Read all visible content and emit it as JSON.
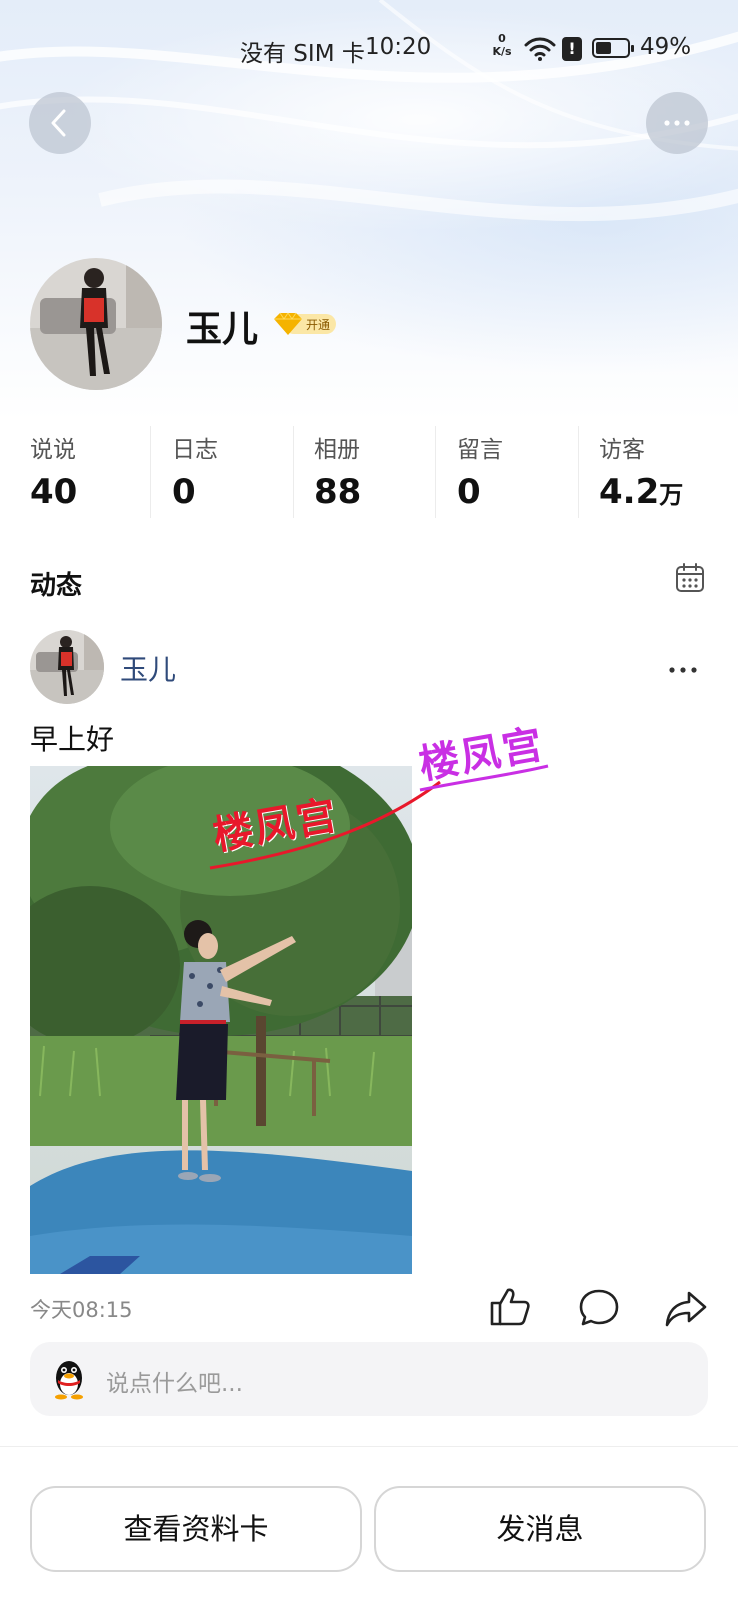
{
  "status_bar": {
    "carrier": "没有 SIM 卡",
    "time": "10:20",
    "net_speed_value": "0",
    "net_speed_unit": "K/s",
    "alert": "!",
    "battery_level": 0.49,
    "battery_percent": "49%"
  },
  "header": {
    "back_icon": "chevron-left-icon",
    "more_icon": "ellipsis-icon"
  },
  "profile": {
    "name": "玉儿",
    "vip_badge_label": "开通",
    "vip_icon": "diamond-icon"
  },
  "stats": [
    {
      "label": "说说",
      "value": "40",
      "unit": ""
    },
    {
      "label": "日志",
      "value": "0",
      "unit": ""
    },
    {
      "label": "相册",
      "value": "88",
      "unit": ""
    },
    {
      "label": "留言",
      "value": "0",
      "unit": ""
    },
    {
      "label": "访客",
      "value": "4.2",
      "unit": "万"
    }
  ],
  "feed": {
    "title": "动态",
    "calendar_icon": "calendar-icon"
  },
  "post": {
    "author": "玉儿",
    "text": "早上好",
    "watermark_1": "楼凤宫",
    "watermark_2": "楼凤宫",
    "time": "今天08:15",
    "actions": [
      "like-icon",
      "comment-icon",
      "share-icon"
    ]
  },
  "comment_input": {
    "placeholder": "说点什么吧..."
  },
  "bottom_actions": {
    "view_card": "查看资料卡",
    "send_message": "发消息"
  },
  "colors": {
    "author_link": "#2f4a7a",
    "watermark_red": "#e8182b",
    "watermark_purple": "#c92fe4",
    "vip_gold": "#f5b300"
  }
}
